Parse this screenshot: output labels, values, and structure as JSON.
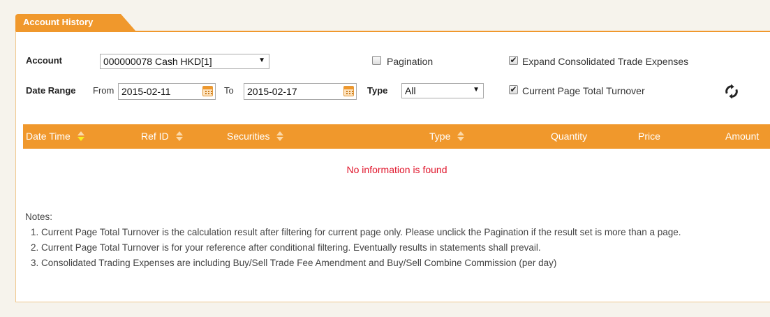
{
  "tab": {
    "title": "Account History"
  },
  "filters": {
    "account_label": "Account",
    "account_value": "000000078 Cash HKD[1]",
    "pagination_label": "Pagination",
    "pagination_checked": false,
    "expand_label": "Expand Consolidated Trade Expenses",
    "expand_checked": true,
    "date_range_label": "Date Range",
    "from_label": "From",
    "from_value": "2015-02-11",
    "to_label": "To",
    "to_value": "2015-02-17",
    "type_label": "Type",
    "type_value": "All",
    "turnover_label": "Current Page Total Turnover",
    "turnover_checked": true
  },
  "table": {
    "columns": [
      "Date Time",
      "Ref ID",
      "Securities",
      "Type",
      "Quantity",
      "Price",
      "Amount"
    ],
    "empty_message": "No information is found"
  },
  "notes": {
    "heading": "Notes:",
    "items": [
      "Current Page Total Turnover is the calculation result after filtering for current page only. Please unclick the Pagination if the result set is more than a page.",
      "Current Page Total Turnover is for your reference after conditional filtering. Eventually results in statements shall prevail.",
      "Consolidated Trading Expenses are including Buy/Sell Trade Fee Amendment and Buy/Sell Combine Commission (per day)"
    ]
  },
  "colors": {
    "accent": "#f0982c",
    "error": "#e0142a",
    "sort_active": "#f7ee21"
  },
  "icons": [
    "calendar-icon",
    "refresh-icon",
    "sort-icon",
    "checkbox-icon"
  ]
}
